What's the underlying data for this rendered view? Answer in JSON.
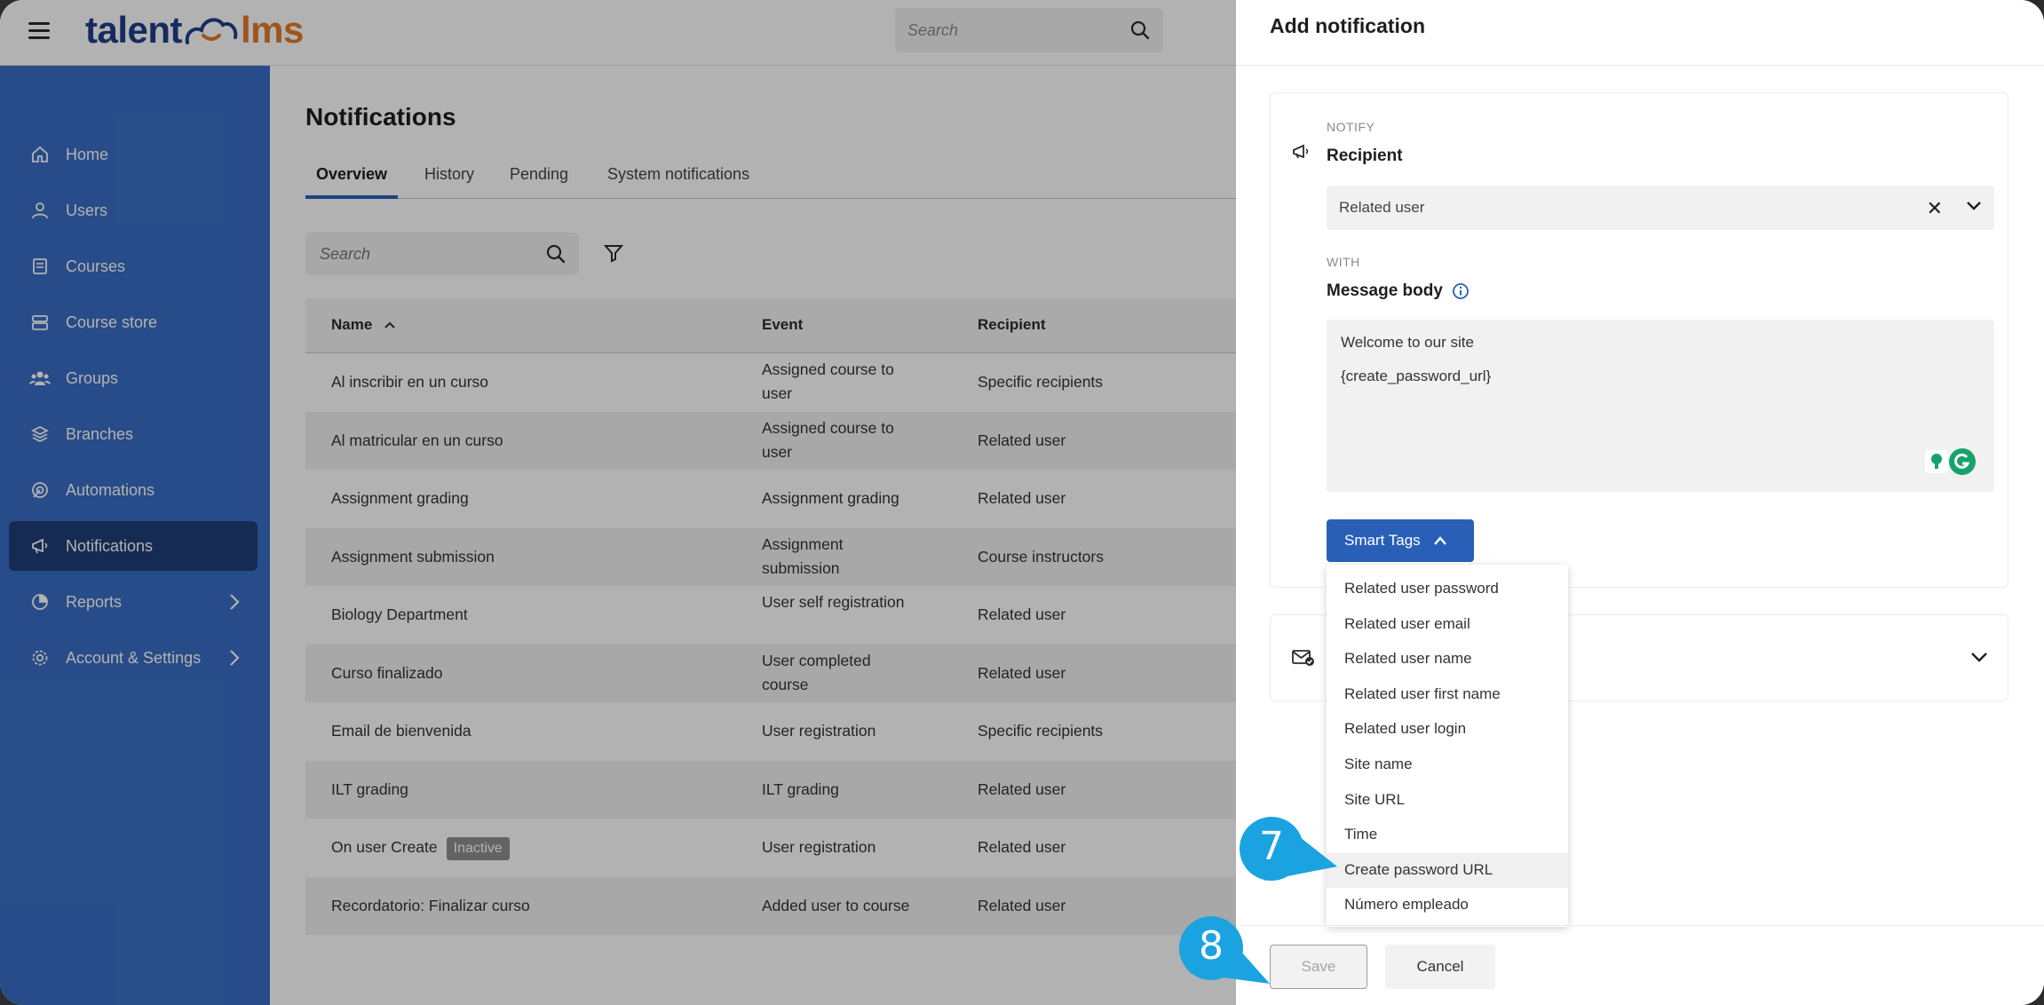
{
  "app": {
    "logo_part1": "talent",
    "logo_part2": "lms",
    "brand_blue": "#1f3e8c",
    "brand_orange": "#e07c2a",
    "sidebar_color": "#3a6ec4",
    "accent": "#2a5fb8"
  },
  "topbar": {
    "search_placeholder": "Search"
  },
  "sidebar": {
    "items": [
      {
        "label": "Home",
        "icon": "home-icon"
      },
      {
        "label": "Users",
        "icon": "user-icon"
      },
      {
        "label": "Courses",
        "icon": "book-icon"
      },
      {
        "label": "Course store",
        "icon": "store-icon"
      },
      {
        "label": "Groups",
        "icon": "groups-icon"
      },
      {
        "label": "Branches",
        "icon": "layers-icon"
      },
      {
        "label": "Automations",
        "icon": "automation-icon"
      },
      {
        "label": "Notifications",
        "icon": "megaphone-icon",
        "active": true
      },
      {
        "label": "Reports",
        "icon": "pie-chart-icon",
        "has_submenu": true
      },
      {
        "label": "Account & Settings",
        "icon": "gear-icon",
        "has_submenu": true
      }
    ]
  },
  "main": {
    "title": "Notifications",
    "tabs": [
      "Overview",
      "History",
      "Pending",
      "System notifications"
    ],
    "active_tab": "Overview",
    "search_placeholder": "Search",
    "table": {
      "headers": {
        "name": "Name",
        "event": "Event",
        "recipient": "Recipient"
      },
      "rows": [
        {
          "name": "Al inscribir en un curso",
          "event": "Assigned course to user",
          "recipient": "Specific recipients"
        },
        {
          "name": "Al matricular en un curso",
          "event": "Assigned course to user",
          "recipient": "Related user"
        },
        {
          "name": "Assignment grading",
          "event": "Assignment grading",
          "recipient": "Related user"
        },
        {
          "name": "Assignment submission",
          "event": "Assignment submission",
          "recipient": "Course instructors"
        },
        {
          "name": "Biology Department",
          "event": "User self registration",
          "recipient": "Related user"
        },
        {
          "name": "Curso finalizado",
          "event": "User completed course",
          "recipient": "Related user"
        },
        {
          "name": "Email de bienvenida",
          "event": "User registration",
          "recipient": "Specific recipients"
        },
        {
          "name": "ILT grading",
          "event": "ILT grading",
          "recipient": "Related user"
        },
        {
          "name": "On user Create",
          "badge": "Inactive",
          "event": "User registration",
          "recipient": "Related user"
        },
        {
          "name": "Recordatorio: Finalizar curso",
          "event": "Added user to course",
          "recipient": "Related user"
        }
      ]
    }
  },
  "panel": {
    "title": "Add notification",
    "notify_label": "NOTIFY",
    "recipient_label": "Recipient",
    "recipient_value": "Related user",
    "with_label": "WITH",
    "message_label": "Message body",
    "message_lines": [
      "Welcome to our site",
      "{create_password_url}"
    ],
    "smart_tags_label": "Smart Tags",
    "smart_tags": [
      "Related user password",
      "Related user email",
      "Related user name",
      "Related user first name",
      "Related user login",
      "Site name",
      "Site URL",
      "Time",
      "Create password URL",
      "Número empleado"
    ],
    "highlighted_tag": "Create password URL",
    "save_label": "Save",
    "cancel_label": "Cancel"
  },
  "callouts": [
    {
      "number": "7"
    },
    {
      "number": "8"
    }
  ],
  "callout_color": "#1aa3e0"
}
